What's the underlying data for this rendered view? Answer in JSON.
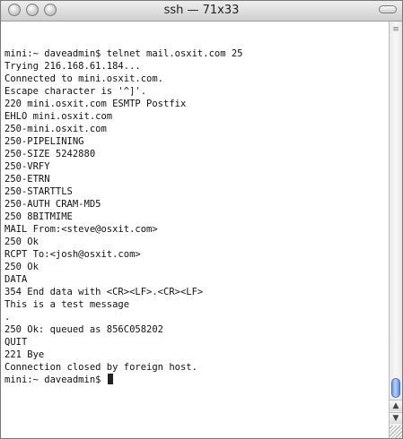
{
  "window": {
    "title": "ssh — 71x33"
  },
  "terminal": {
    "lines": [
      "mini:~ daveadmin$ telnet mail.osxit.com 25",
      "Trying 216.168.61.184...",
      "Connected to mini.osxit.com.",
      "Escape character is '^]'.",
      "220 mini.osxit.com ESMTP Postfix",
      "EHLO mini.osxit.com",
      "250-mini.osxit.com",
      "250-PIPELINING",
      "250-SIZE 5242880",
      "250-VRFY",
      "250-ETRN",
      "250-STARTTLS",
      "250-AUTH CRAM-MD5",
      "250 8BITMIME",
      "MAIL From:<steve@osxit.com>",
      "250 Ok",
      "RCPT To:<josh@osxit.com>",
      "250 Ok",
      "DATA",
      "354 End data with <CR><LF>.<CR><LF>",
      "This is a test message",
      ".",
      "250 Ok: queued as 856C058202",
      "QUIT",
      "221 Bye",
      "Connection closed by foreign host."
    ],
    "prompt": "mini:~ daveadmin$ "
  },
  "icons": {
    "close": "close-button-icon",
    "minimize": "minimize-button-icon",
    "zoom": "zoom-button-icon",
    "scroll_up": "scroll-up-arrow-icon",
    "scroll_down": "scroll-down-arrow-icon",
    "resize": "resize-grip-icon"
  }
}
